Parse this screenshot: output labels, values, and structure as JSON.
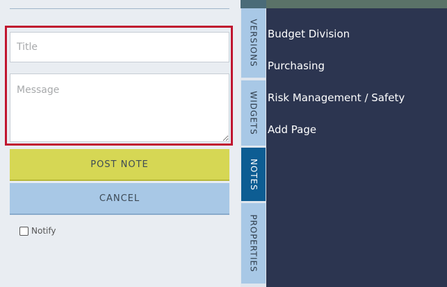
{
  "notes_form": {
    "title_placeholder": "Title",
    "title_value": "",
    "message_placeholder": "Message",
    "message_value": "",
    "post_button_label": "POST NOTE",
    "cancel_button_label": "CANCEL",
    "notify_label": "Notify",
    "notify_checked": false,
    "highlight_color": "#c0152f"
  },
  "tabs": [
    {
      "label": "VERSIONS",
      "active": false
    },
    {
      "label": "WIDGETS",
      "active": false
    },
    {
      "label": "NOTES",
      "active": true
    },
    {
      "label": "PROPERTIES",
      "active": false
    }
  ],
  "pages": [
    {
      "label": "Budget Division"
    },
    {
      "label": "Purchasing"
    },
    {
      "label": "Risk Management / Safety"
    },
    {
      "label": "Add Page"
    }
  ],
  "colors": {
    "post_button": "#d6d754",
    "cancel_button": "#a8c8e6",
    "active_tab": "#0d5d93",
    "dark_panel": "#2c3550"
  }
}
